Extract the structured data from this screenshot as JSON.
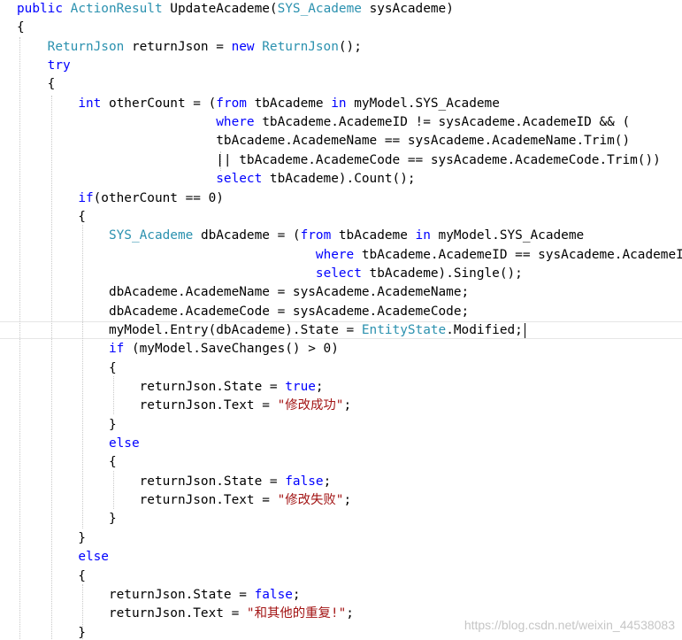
{
  "editor": {
    "lines": [
      {
        "segments": [
          {
            "t": "kw",
            "v": "public "
          },
          {
            "t": "ty",
            "v": "ActionResult"
          },
          {
            "t": "tx",
            "v": " UpdateAcademe("
          },
          {
            "t": "ty",
            "v": "SYS_Academe"
          },
          {
            "t": "tx",
            "v": " sysAcademe)"
          }
        ]
      },
      {
        "segments": [
          {
            "t": "tx",
            "v": "{"
          }
        ]
      },
      {
        "segments": [
          {
            "t": "tx",
            "v": "    "
          },
          {
            "t": "ty",
            "v": "ReturnJson"
          },
          {
            "t": "tx",
            "v": " returnJson = "
          },
          {
            "t": "kw",
            "v": "new "
          },
          {
            "t": "ty",
            "v": "ReturnJson"
          },
          {
            "t": "tx",
            "v": "();"
          }
        ]
      },
      {
        "segments": [
          {
            "t": "tx",
            "v": "    "
          },
          {
            "t": "kw",
            "v": "try"
          }
        ]
      },
      {
        "segments": [
          {
            "t": "tx",
            "v": "    {"
          }
        ]
      },
      {
        "segments": [
          {
            "t": "tx",
            "v": "        "
          },
          {
            "t": "kw",
            "v": "int"
          },
          {
            "t": "tx",
            "v": " otherCount = ("
          },
          {
            "t": "kw",
            "v": "from"
          },
          {
            "t": "tx",
            "v": " tbAcademe "
          },
          {
            "t": "kw",
            "v": "in"
          },
          {
            "t": "tx",
            "v": " myModel.SYS_Academe"
          }
        ]
      },
      {
        "segments": [
          {
            "t": "tx",
            "v": "                          "
          },
          {
            "t": "kw",
            "v": "where"
          },
          {
            "t": "tx",
            "v": " tbAcademe.AcademeID != sysAcademe.AcademeID && ("
          }
        ]
      },
      {
        "segments": [
          {
            "t": "tx",
            "v": "                          tbAcademe.AcademeName == sysAcademe.AcademeName.Trim()"
          }
        ]
      },
      {
        "segments": [
          {
            "t": "tx",
            "v": "                          || tbAcademe.AcademeCode == sysAcademe.AcademeCode.Trim())"
          }
        ]
      },
      {
        "segments": [
          {
            "t": "tx",
            "v": "                          "
          },
          {
            "t": "kw",
            "v": "select"
          },
          {
            "t": "tx",
            "v": " tbAcademe).Count();"
          }
        ]
      },
      {
        "segments": [
          {
            "t": "tx",
            "v": "        "
          },
          {
            "t": "kw",
            "v": "if"
          },
          {
            "t": "tx",
            "v": "(otherCount == 0)"
          }
        ]
      },
      {
        "segments": [
          {
            "t": "tx",
            "v": "        {"
          }
        ]
      },
      {
        "segments": [
          {
            "t": "tx",
            "v": "            "
          },
          {
            "t": "ty",
            "v": "SYS_Academe"
          },
          {
            "t": "tx",
            "v": " dbAcademe = ("
          },
          {
            "t": "kw",
            "v": "from"
          },
          {
            "t": "tx",
            "v": " tbAcademe "
          },
          {
            "t": "kw",
            "v": "in"
          },
          {
            "t": "tx",
            "v": " myModel.SYS_Academe"
          }
        ]
      },
      {
        "segments": [
          {
            "t": "tx",
            "v": "                                       "
          },
          {
            "t": "kw",
            "v": "where"
          },
          {
            "t": "tx",
            "v": " tbAcademe.AcademeID == sysAcademe.AcademeID"
          }
        ]
      },
      {
        "segments": [
          {
            "t": "tx",
            "v": "                                       "
          },
          {
            "t": "kw",
            "v": "select"
          },
          {
            "t": "tx",
            "v": " tbAcademe).Single();"
          }
        ]
      },
      {
        "segments": [
          {
            "t": "tx",
            "v": "            dbAcademe.AcademeName = sysAcademe.AcademeName;"
          }
        ]
      },
      {
        "segments": [
          {
            "t": "tx",
            "v": "            dbAcademe.AcademeCode = sysAcademe.AcademeCode;"
          }
        ]
      },
      {
        "segments": [
          {
            "t": "tx",
            "v": "            myModel.Entry(dbAcademe).State = "
          },
          {
            "t": "ty",
            "v": "EntityState"
          },
          {
            "t": "tx",
            "v": ".Modified;"
          }
        ]
      },
      {
        "segments": [
          {
            "t": "tx",
            "v": "            "
          },
          {
            "t": "kw",
            "v": "if"
          },
          {
            "t": "tx",
            "v": " (myModel.SaveChanges() > 0)"
          }
        ]
      },
      {
        "segments": [
          {
            "t": "tx",
            "v": "            {"
          }
        ]
      },
      {
        "segments": [
          {
            "t": "tx",
            "v": "                returnJson.State = "
          },
          {
            "t": "kw",
            "v": "true"
          },
          {
            "t": "tx",
            "v": ";"
          }
        ]
      },
      {
        "segments": [
          {
            "t": "tx",
            "v": "                returnJson.Text = "
          },
          {
            "t": "st",
            "v": "\"修改成功\""
          },
          {
            "t": "tx",
            "v": ";"
          }
        ]
      },
      {
        "segments": [
          {
            "t": "tx",
            "v": "            }"
          }
        ]
      },
      {
        "segments": [
          {
            "t": "tx",
            "v": "            "
          },
          {
            "t": "kw",
            "v": "else"
          }
        ]
      },
      {
        "segments": [
          {
            "t": "tx",
            "v": "            {"
          }
        ]
      },
      {
        "segments": [
          {
            "t": "tx",
            "v": "                returnJson.State = "
          },
          {
            "t": "kw",
            "v": "false"
          },
          {
            "t": "tx",
            "v": ";"
          }
        ]
      },
      {
        "segments": [
          {
            "t": "tx",
            "v": "                returnJson.Text = "
          },
          {
            "t": "st",
            "v": "\"修改失败\""
          },
          {
            "t": "tx",
            "v": ";"
          }
        ]
      },
      {
        "segments": [
          {
            "t": "tx",
            "v": "            }"
          }
        ]
      },
      {
        "segments": [
          {
            "t": "tx",
            "v": "        }"
          }
        ]
      },
      {
        "segments": [
          {
            "t": "tx",
            "v": "        "
          },
          {
            "t": "kw",
            "v": "else"
          }
        ]
      },
      {
        "segments": [
          {
            "t": "tx",
            "v": "        {"
          }
        ]
      },
      {
        "segments": [
          {
            "t": "tx",
            "v": "            returnJson.State = "
          },
          {
            "t": "kw",
            "v": "false"
          },
          {
            "t": "tx",
            "v": ";"
          }
        ]
      },
      {
        "segments": [
          {
            "t": "tx",
            "v": "            returnJson.Text = "
          },
          {
            "t": "st",
            "v": "\"和其他的重复!\""
          },
          {
            "t": "tx",
            "v": ";"
          }
        ]
      },
      {
        "segments": [
          {
            "t": "tx",
            "v": "        }"
          }
        ]
      }
    ],
    "caret_line_index": 17
  },
  "colors": {
    "keyword": "#0000ff",
    "type": "#2b91af",
    "string": "#a31515",
    "text": "#000000",
    "background": "#ffffff"
  },
  "watermark": {
    "text": "https://blog.csdn.net/weixin_44538083"
  }
}
